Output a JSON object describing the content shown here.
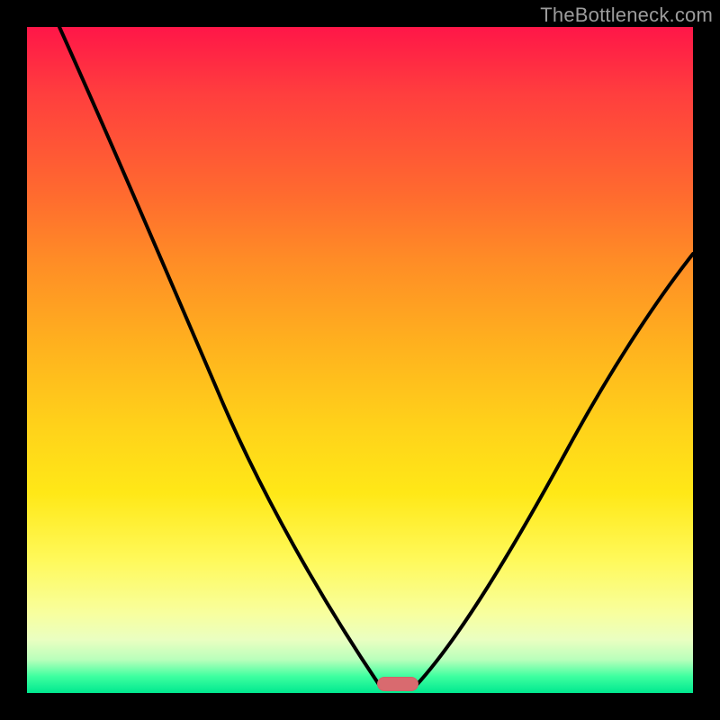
{
  "watermark": "TheBottleneck.com",
  "chart_data": {
    "type": "line",
    "title": "",
    "xlabel": "",
    "ylabel": "",
    "xlim": [
      0,
      100
    ],
    "ylim": [
      0,
      100
    ],
    "grid": false,
    "series": [
      {
        "name": "bottleneck-curve",
        "x": [
          5,
          10,
          15,
          20,
          25,
          30,
          35,
          40,
          45,
          50,
          53,
          56,
          58,
          60,
          65,
          70,
          75,
          80,
          85,
          90,
          95,
          100
        ],
        "values": [
          100,
          92,
          82,
          73,
          64,
          57,
          48,
          38,
          28,
          15,
          5,
          0,
          0,
          3,
          12,
          22,
          31,
          40,
          48,
          55,
          61,
          66
        ]
      }
    ],
    "marker": {
      "x": 56,
      "y": 0
    },
    "colors": {
      "gradient_top": "#ff1648",
      "gradient_bottom": "#00e88f",
      "curve": "#000000",
      "marker": "#d96a6f",
      "frame": "#000000"
    }
  }
}
